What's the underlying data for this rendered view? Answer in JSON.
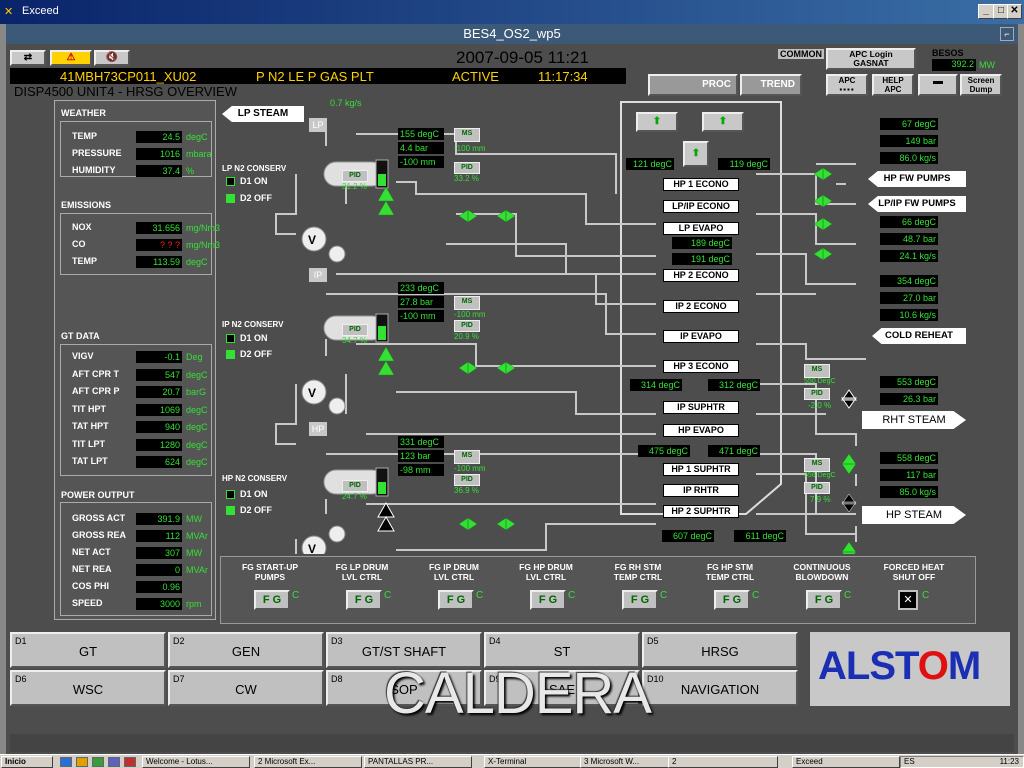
{
  "window": {
    "title": "Exceed"
  },
  "hmi": {
    "header_title": "BES4_OS2_wp5",
    "datetime": "2007-09-05  11:21",
    "common_label": "COMMON",
    "apc_login": "APC Login\nGASNAT",
    "besos_label": "BESOS",
    "besos_value": "392.2",
    "besos_unit": "MW",
    "tag": "41MBH73CP011_XU02",
    "tag_desc": "P N2 LE P GAS PLT",
    "status": "ACTIVE",
    "status_time": "11:17:34",
    "display_title": "DISP4500  UNIT4 - HRSG OVERVIEW",
    "proc_label": "PROC",
    "trend_label": "TREND",
    "apc_label": "APC",
    "help_apc_label": "HELP\nAPC",
    "screen_dump_label": "Screen\nDump"
  },
  "weather": {
    "title": "WEATHER",
    "rows": [
      {
        "label": "TEMP",
        "value": "24.5",
        "unit": "degC"
      },
      {
        "label": "PRESSURE",
        "value": "1016",
        "unit": "mbara"
      },
      {
        "label": "HUMIDITY",
        "value": "37.4",
        "unit": "%"
      }
    ]
  },
  "emissions": {
    "title": "EMISSIONS",
    "rows": [
      {
        "label": "NOX",
        "value": "31.656",
        "unit": "mg/Nm3"
      },
      {
        "label": "CO",
        "value": "? ? ?",
        "unit": "mg/Nm3"
      },
      {
        "label": "TEMP",
        "value": "113.59",
        "unit": "degC"
      }
    ]
  },
  "gt_data": {
    "title": "GT DATA",
    "rows": [
      {
        "label": "VIGV",
        "value": "-0.1",
        "unit": "Deg"
      },
      {
        "label": "AFT CPR T",
        "value": "547",
        "unit": "degC"
      },
      {
        "label": "AFT CPR P",
        "value": "20.7",
        "unit": "barG"
      },
      {
        "label": "TIT HPT",
        "value": "1069",
        "unit": "degC"
      },
      {
        "label": "TAT HPT",
        "value": "940",
        "unit": "degC"
      },
      {
        "label": "TIT LPT",
        "value": "1280",
        "unit": "degC"
      },
      {
        "label": "TAT LPT",
        "value": "624",
        "unit": "degC"
      }
    ]
  },
  "power_output": {
    "title": "POWER OUTPUT",
    "rows": [
      {
        "label": "GROSS ACT",
        "value": "391.9",
        "unit": "MW"
      },
      {
        "label": "GROSS REA",
        "value": "112",
        "unit": "MVAr"
      },
      {
        "label": "NET ACT",
        "value": "307",
        "unit": "MW"
      },
      {
        "label": "NET REA",
        "value": "0",
        "unit": "MVAr"
      },
      {
        "label": "COS PHI",
        "value": "0.96",
        "unit": ""
      },
      {
        "label": "SPEED",
        "value": "3000",
        "unit": "rpm"
      }
    ]
  },
  "lp_section": {
    "steam_label": "LP STEAM",
    "flow": "0.7 kg/s",
    "tag": "LP",
    "conserv_title": "LP N2 CONSERV",
    "d1": "D1  ON",
    "d2": "D2  OFF",
    "temp": "155 degC",
    "press": "4.4 bar",
    "level": "-100 mm",
    "pid_val": "31.2 %",
    "ms_val": "-100 mm",
    "pid2_val": "33.2 %"
  },
  "ip_section": {
    "tag": "IP",
    "conserv_title": "IP N2 CONSERV",
    "d1": "D1  ON",
    "d2": "D2  OFF",
    "temp": "233 degC",
    "press": "27.8 bar",
    "level": "-100 mm",
    "pid_val": "34.7 %",
    "ms_val": "-100 mm",
    "pid2_val": "20.9 %"
  },
  "hp_section": {
    "tag": "HP",
    "conserv_title": "HP N2 CONSERV",
    "d1": "D1  ON",
    "d2": "D2  OFF",
    "temp": "331 degC",
    "press": "123 bar",
    "level": "-98 mm",
    "pid_val": "24.7 %",
    "ms_val": "-100 mm",
    "pid2_val": "36.9 %"
  },
  "hrsg": {
    "top_left_temp": "121 degC",
    "top_right_temp": "119 degC",
    "mid_temp1": "189 degC",
    "mid_temp2": "191 degC",
    "ip_left_temp": "314 degC",
    "ip_right_temp": "312 degC",
    "hp_left_temp": "475 degC",
    "hp_right_temp": "471 degC",
    "bot_left_temp": "607 degC",
    "bot_right_temp": "611 degC",
    "hp1_econo": "HP 1 ECONO",
    "lpip_econo": "LP/IP ECONO",
    "lp_evapo": "LP EVAPO",
    "hp2_econo": "HP 2 ECONO",
    "ip2_econo": "IP 2 ECONO",
    "ip_evapo": "IP EVAPO",
    "hp3_econo": "HP 3 ECONO",
    "ip_suphtr": "IP SUPHTR",
    "hp_evapo": "HP EVAPO",
    "hp1_suphtr": "HP 1 SUPHTR",
    "ip_rhtr": "IP RHTR",
    "hp2_suphtr": "HP 2 SUPHTR"
  },
  "right_side": {
    "hp_fw_temp": "67 degC",
    "hp_fw_press": "149 bar",
    "hp_fw_flow": "86.0 kg/s",
    "hp_fw_pumps": "HP FW PUMPS",
    "lpip_fw_pumps": "LP/IP FW PUMPS",
    "lpip_temp": "66 degC",
    "lpip_press": "48.7 bar",
    "lpip_flow": "24.1 kg/s",
    "cr_temp": "354 degC",
    "cr_press": "27.0 bar",
    "cr_flow": "10.6 kg/s",
    "cold_reheat": "COLD REHEAT",
    "rht_temp": "553 degC",
    "rht_press": "26.3 bar",
    "rht_steam": "RHT STEAM",
    "rht_pid": "-2.0 %",
    "rht_ms": "550 DegC",
    "hps_temp": "558 degC",
    "hps_press": "117 bar",
    "hps_flow": "85.0 kg/s",
    "hp_steam": "HP STEAM",
    "hps_pid": "7.9 %",
    "hps_ms": "556 DegC"
  },
  "fg_controls": [
    {
      "label": "FG START-UP\nPUMPS",
      "btn": "F G",
      "c": "C"
    },
    {
      "label": "FG LP DRUM\nLVL CTRL",
      "btn": "F G",
      "c": "C"
    },
    {
      "label": "FG IP DRUM\nLVL CTRL",
      "btn": "F G",
      "c": "C"
    },
    {
      "label": "FG HP DRUM\nLVL CTRL",
      "btn": "F G",
      "c": "C"
    },
    {
      "label": "FG RH STM\nTEMP CTRL",
      "btn": "F G",
      "c": "C"
    },
    {
      "label": "FG HP STM\nTEMP CTRL",
      "btn": "F G",
      "c": "C"
    },
    {
      "label": "CONTINUOUS\nBLOWDOWN",
      "btn": "F G",
      "c": "C"
    },
    {
      "label": "FORCED HEAT\nSHUT OFF",
      "btn": "",
      "c": "C"
    }
  ],
  "nav": [
    {
      "id": "D1",
      "label": "GT"
    },
    {
      "id": "D2",
      "label": "GEN"
    },
    {
      "id": "D3",
      "label": "GT/ST SHAFT"
    },
    {
      "id": "D4",
      "label": "ST"
    },
    {
      "id": "D5",
      "label": "HRSG"
    },
    {
      "id": "D6",
      "label": "WSC"
    },
    {
      "id": "D7",
      "label": "CW"
    },
    {
      "id": "D8",
      "label": "SOP"
    },
    {
      "id": "D9",
      "label": "SAE"
    },
    {
      "id": "D10",
      "label": "NAVIGATION"
    }
  ],
  "logo": "ALSTOM",
  "overlay_text": "CALDERA",
  "taskbar": {
    "start": "Inicio",
    "items": [
      "Welcome - Lotus...",
      "2 Microsoft Ex...",
      "PANTALLAS PR...",
      "X-Terminal",
      "3 Microsoft W...",
      "2",
      "Exceed"
    ],
    "tray_lang": "ES",
    "clock": "11:23"
  },
  "colors": {
    "accent_green": "#35e035",
    "value_yellow": "#ffd200",
    "alstom_blue": "#1a2fb4",
    "alstom_red": "#e01010"
  }
}
